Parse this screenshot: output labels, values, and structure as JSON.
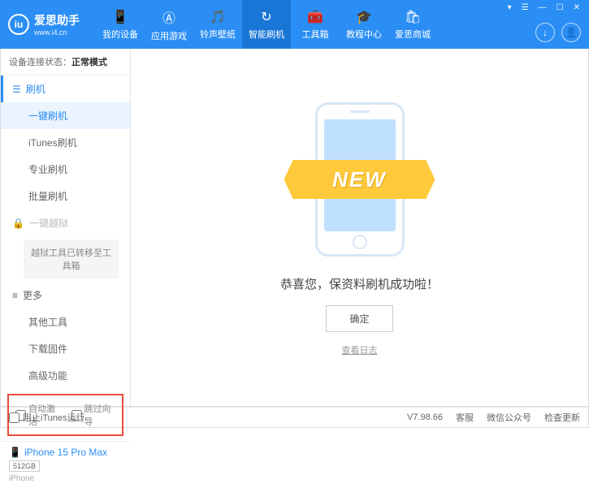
{
  "header": {
    "logo_letter": "iu",
    "title": "爱思助手",
    "url": "www.i4.cn",
    "nav": [
      {
        "icon": "📱",
        "label": "我的设备"
      },
      {
        "icon": "Ⓐ",
        "label": "应用游戏"
      },
      {
        "icon": "🎵",
        "label": "铃声壁纸"
      },
      {
        "icon": "↻",
        "label": "智能刷机"
      },
      {
        "icon": "🧰",
        "label": "工具箱"
      },
      {
        "icon": "🎓",
        "label": "教程中心"
      },
      {
        "icon": "🛍",
        "label": "爱思商城"
      }
    ],
    "active_nav": 3,
    "win_controls": {
      "menu": "▾",
      "grid": "☰",
      "min": "—",
      "max": "☐",
      "close": "✕"
    },
    "circle1": "↓",
    "circle2": "👤"
  },
  "sidebar": {
    "status_label": "设备连接状态：",
    "status_value": "正常模式",
    "section_flash": "刷机",
    "items_flash": [
      "一键刷机",
      "iTunes刷机",
      "专业刷机",
      "批量刷机"
    ],
    "section_jail": "一键越狱",
    "jail_box": "越狱工具已转移至工具箱",
    "section_more": "更多",
    "items_more": [
      "其他工具",
      "下载固件",
      "高级功能"
    ],
    "cb_auto": "自动激活",
    "cb_skip": "跳过向导",
    "device": {
      "icon": "📱",
      "name": "iPhone 15 Pro Max",
      "storage": "512GB",
      "type": "iPhone"
    }
  },
  "main": {
    "banner": "NEW",
    "success": "恭喜您，保资料刷机成功啦！",
    "ok": "确定",
    "log": "查看日志"
  },
  "footer": {
    "block_itunes": "阻止iTunes运行",
    "version": "V7.98.66",
    "links": [
      "客服",
      "微信公众号",
      "检查更新"
    ]
  }
}
